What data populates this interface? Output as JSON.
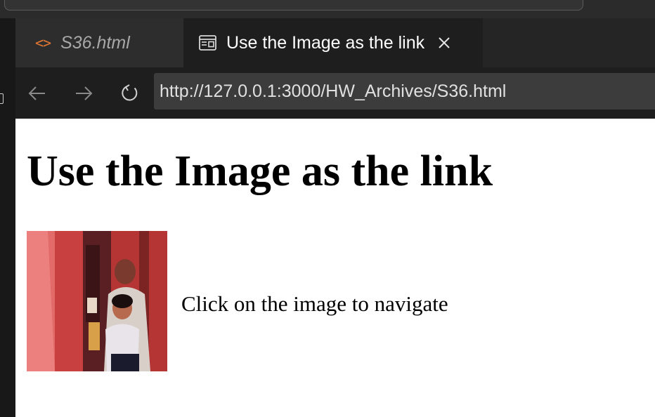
{
  "tabs": [
    {
      "label": "S36.html",
      "icon": "code-icon",
      "active": false
    },
    {
      "label": "Use the Image as the link",
      "icon": "preview-icon",
      "active": true
    }
  ],
  "browser": {
    "url": "http://127.0.0.1:3000/HW_Archives/S36.html"
  },
  "page": {
    "heading": "Use the Image as the link",
    "caption": "Click on the image to navigate"
  },
  "colors": {
    "editor_bg": "#1e1e1e",
    "tab_inactive_bg": "#2d2d2d",
    "url_field_bg": "#3c3c3c",
    "code_icon": "#e37933",
    "page_bg": "#ffffff"
  }
}
